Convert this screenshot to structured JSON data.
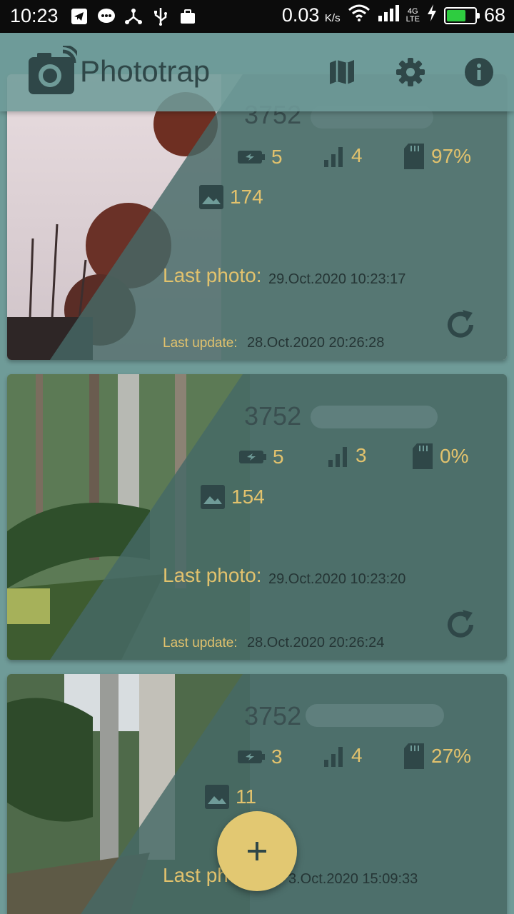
{
  "status_bar": {
    "time": "10:23",
    "net_speed": "0.03",
    "net_unit": "K/s",
    "battery": "68",
    "battery_level": 0.68,
    "icons": [
      "telegram-icon",
      "chat-icon",
      "share-icon",
      "usb-icon",
      "briefcase-icon"
    ]
  },
  "app_bar": {
    "title": "Phototrap",
    "actions": [
      "map-icon",
      "settings-icon",
      "info-icon"
    ]
  },
  "colors": {
    "accent": "#e2c26d",
    "fab": "#e2c872",
    "background": "#6f9b98"
  },
  "cameras": [
    {
      "serial": "3752",
      "battery": "5",
      "signal": "4",
      "storage": "97%",
      "photos": "174",
      "last_photo_label": "Last photo:",
      "last_photo": "29.Oct.2020 10:23:17",
      "last_update_label": "Last update:",
      "last_update": "28.Oct.2020 20:26:28"
    },
    {
      "serial": "3752",
      "battery": "5",
      "signal": "3",
      "storage": "0%",
      "photos": "154",
      "last_photo_label": "Last photo:",
      "last_photo": "29.Oct.2020 10:23:20",
      "last_update_label": "Last update:",
      "last_update": "28.Oct.2020 20:26:24"
    },
    {
      "serial": "3752",
      "battery": "3",
      "signal": "4",
      "storage": "27%",
      "photos": "11",
      "last_photo_label": "Last ph",
      "last_photo": "3.Oct.2020 15:09:33"
    }
  ],
  "fab": {
    "icon": "plus-icon"
  }
}
